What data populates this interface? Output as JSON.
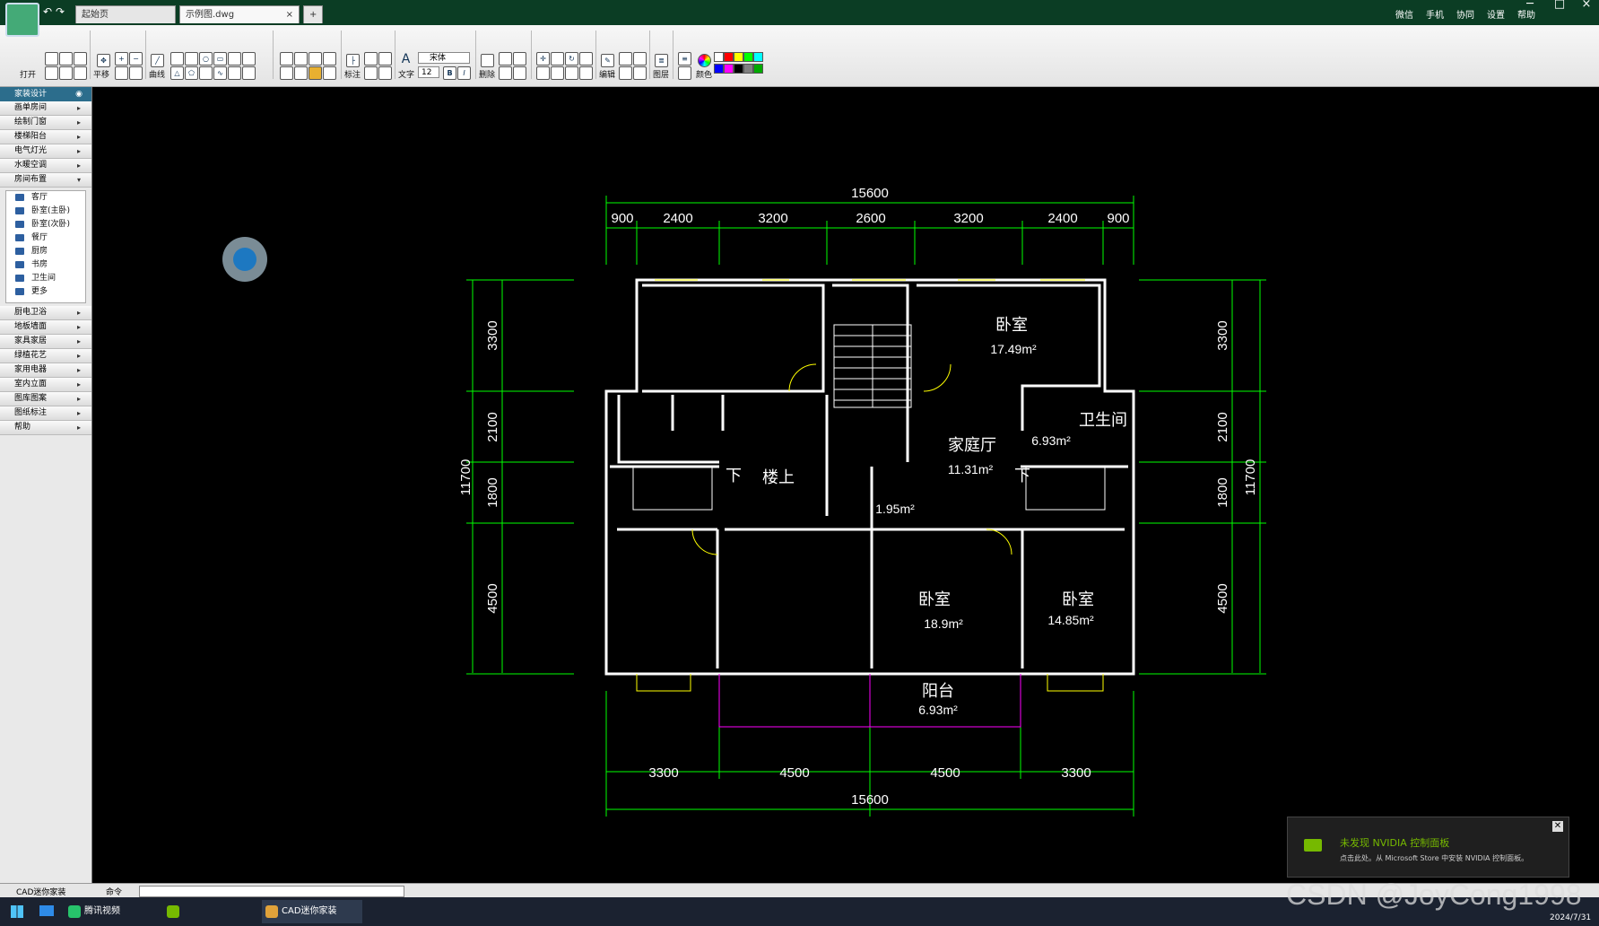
{
  "titlebar": {
    "tabs": [
      {
        "label": "起始页"
      },
      {
        "label": "示例图.dwg"
      }
    ],
    "tab_close": "×",
    "tab_add": "+",
    "right_links": [
      "微信",
      "手机",
      "协同",
      "设置",
      "帮助"
    ],
    "window_controls": [
      "─",
      "□",
      "×"
    ]
  },
  "ribbon": {
    "groups": [
      "打开",
      "平移",
      "曲线",
      "标注",
      "文字",
      "删除",
      "编辑",
      "图层",
      "颜色"
    ],
    "font_name": "宋体",
    "font_size": "12",
    "bold": "B",
    "italic": "I",
    "colors": [
      "#ffffff",
      "#ff0000",
      "#ffff00",
      "#00ff00",
      "#00ffff",
      "#0000ff",
      "#ff00ff",
      "#000000",
      "#808080",
      "#00aa00"
    ]
  },
  "leftpanel": {
    "header": "家装设计",
    "items_top": [
      "画单房间",
      "绘制门窗",
      "楼梯阳台",
      "电气灯光",
      "水暖空调"
    ],
    "open_item": "房间布置",
    "subitems": [
      "客厅",
      "卧室(主卧)",
      "卧室(次卧)",
      "餐厅",
      "厨房",
      "书房",
      "卫生间",
      "更多"
    ],
    "items_bottom": [
      "厨电卫浴",
      "地板墙面",
      "家具家居",
      "绿植花艺",
      "家用电器",
      "室内立面",
      "图库图案",
      "图纸标注",
      "帮助"
    ]
  },
  "drawing": {
    "top_total": "15600",
    "top_dims": [
      "900",
      "2400",
      "3200",
      "2600",
      "3200",
      "2400",
      "900"
    ],
    "bottom_dims": [
      "3300",
      "4500",
      "4500",
      "3300"
    ],
    "bottom_total": "15600",
    "left_dims": [
      "3300",
      "2100",
      "1800",
      "4500"
    ],
    "left_total": "11700",
    "right_dims": [
      "3300",
      "2100",
      "1800",
      "4500"
    ],
    "right_total": "11700",
    "rooms": {
      "bedroom_ne": {
        "name": "卧室",
        "area": "17.49m²"
      },
      "bath": {
        "name": "卫生间",
        "area": "6.93m²"
      },
      "family_hall": {
        "name": "家庭厅",
        "area": "11.31m²"
      },
      "stair_label": "楼上",
      "down_left": "下",
      "down_right": "下",
      "small_area": "1.95m²",
      "bedroom_s": {
        "name": "卧室",
        "area": "18.9m²"
      },
      "bedroom_se": {
        "name": "卧室",
        "area": "14.85m²"
      },
      "balcony": {
        "name": "阳台",
        "area": "6.93m²"
      }
    }
  },
  "toast": {
    "title": "未发现 NVIDIA 控制面板",
    "body": "点击此处。从 Microsoft Store 中安装 NVIDIA 控制面板。",
    "close": "✕"
  },
  "statusbar": {
    "app": "CAD迷你家装",
    "cmd_label": "命令"
  },
  "taskbar": {
    "items": [
      "腾讯视频",
      "",
      "CAD迷你家装"
    ],
    "date": "2024/7/31"
  },
  "watermark": "CSDN @JoyCong1998",
  "colors": {
    "dim_line": "#00ff00",
    "wall": "#ffffff",
    "window": "#ffff00",
    "balcony_rail": "#ff00ff"
  }
}
